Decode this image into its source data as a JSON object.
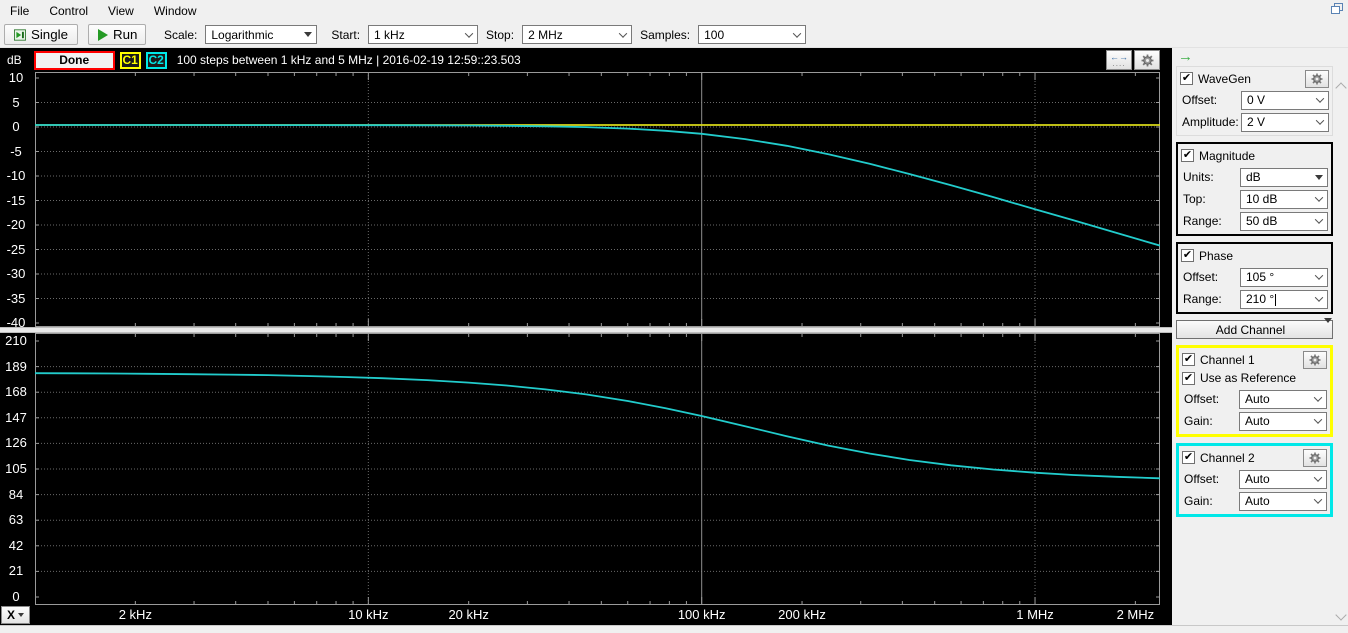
{
  "menu": {
    "items": [
      "File",
      "Control",
      "View",
      "Window"
    ]
  },
  "toolbar": {
    "single_label": "Single",
    "run_label": "Run",
    "scale_label": "Scale:",
    "scale_value": "Logarithmic",
    "start_label": "Start:",
    "start_value": "1 kHz",
    "stop_label": "Stop:",
    "stop_value": "2 MHz",
    "samples_label": "Samples:",
    "samples_value": "100"
  },
  "statusbar": {
    "axis_unit": "dB",
    "done_label": "Done",
    "c1_label": "C1",
    "c2_label": "C2",
    "status_text": "100 steps between 1 kHz and 5 MHz | 2016-02-19 12:59::23.503"
  },
  "panel": {
    "wavegen": {
      "title": "WaveGen",
      "offset_label": "Offset:",
      "offset_value": "0 V",
      "amplitude_label": "Amplitude:",
      "amplitude_value": "2 V"
    },
    "magnitude": {
      "title": "Magnitude",
      "units_label": "Units:",
      "units_value": "dB",
      "top_label": "Top:",
      "top_value": "10 dB",
      "range_label": "Range:",
      "range_value": "50 dB"
    },
    "phase": {
      "title": "Phase",
      "offset_label": "Offset:",
      "offset_value": "105 °",
      "range_label": "Range:",
      "range_value": "210 °"
    },
    "add_channel_label": "Add Channel",
    "channel1": {
      "title": "Channel 1",
      "use_ref_label": "Use as Reference",
      "offset_label": "Offset:",
      "offset_value": "Auto",
      "gain_label": "Gain:",
      "gain_value": "Auto"
    },
    "channel2": {
      "title": "Channel 2",
      "offset_label": "Offset:",
      "offset_value": "Auto",
      "gain_label": "Gain:",
      "gain_value": "Auto"
    }
  },
  "xaxis": {
    "button_label": "X",
    "ticks": [
      {
        "hz": 2000,
        "label": "2 kHz"
      },
      {
        "hz": 10000,
        "label": "10 kHz"
      },
      {
        "hz": 20000,
        "label": "20 kHz"
      },
      {
        "hz": 100000,
        "label": "100 kHz"
      },
      {
        "hz": 200000,
        "label": "200 kHz"
      },
      {
        "hz": 1000000,
        "label": "1 MHz"
      },
      {
        "hz": 2000000,
        "label": "2 MHz"
      }
    ]
  },
  "colors": {
    "c1_trace": "#d9d919",
    "c2_trace": "#22cccc",
    "grid_dotted": "#6a6a6a",
    "grid_solid": "#8d8d8d",
    "plot_border": "#9a9a9a",
    "done_border": "#ff0000",
    "c1_badge": "#ffff00",
    "c2_badge": "#00e8e8",
    "run_green": "#259a25",
    "panel_arrow_green": "#3fae49"
  },
  "chart_data": [
    {
      "type": "line",
      "title": "Magnitude",
      "x_scale": "log",
      "x_range_hz": [
        1000,
        2371000
      ],
      "ylabel": "dB",
      "ylim": [
        -40,
        10
      ],
      "yticks": [
        10,
        5,
        0,
        -5,
        -10,
        -15,
        -20,
        -25,
        -30,
        -35,
        -40
      ],
      "grid_y": [
        5,
        0,
        -5,
        -10,
        -15,
        -20,
        -25,
        -30,
        -35
      ],
      "x_grid": [
        {
          "hz": 10000,
          "style": "dotted"
        },
        {
          "hz": 100000,
          "style": "solid"
        },
        {
          "hz": 1000000,
          "style": "dotted"
        }
      ],
      "x_hz": [
        1000,
        1300,
        1700,
        2200,
        2900,
        3800,
        5000,
        6500,
        8500,
        11000,
        15000,
        20000,
        26000,
        34000,
        45000,
        60000,
        78000,
        100000,
        135000,
        180000,
        240000,
        320000,
        420000,
        560000,
        750000,
        1000000,
        1300000,
        1750000,
        2371000
      ],
      "series": [
        {
          "name": "C1",
          "color": "#d9d919",
          "y": [
            0.4,
            0.4,
            0.4,
            0.4,
            0.4,
            0.4,
            0.4,
            0.4,
            0.4,
            0.4,
            0.4,
            0.4,
            0.4,
            0.4,
            0.4,
            0.4,
            0.4,
            0.4,
            0.4,
            0.4,
            0.4,
            0.4,
            0.4,
            0.4,
            0.4,
            0.4,
            0.4,
            0.4,
            0.4
          ]
        },
        {
          "name": "C2",
          "color": "#22cccc",
          "y": [
            0.4,
            0.4,
            0.4,
            0.4,
            0.4,
            0.39,
            0.39,
            0.38,
            0.37,
            0.37,
            0.35,
            0.31,
            0.25,
            0.15,
            -0.03,
            -0.33,
            -0.77,
            -1.39,
            -2.46,
            -3.84,
            -5.55,
            -7.54,
            -9.6,
            -11.9,
            -14.3,
            -16.8,
            -19.0,
            -21.6,
            -24.2
          ]
        }
      ]
    },
    {
      "type": "line",
      "title": "Phase",
      "x_scale": "log",
      "x_range_hz": [
        1000,
        2371000
      ],
      "ylabel": "°",
      "ylim": [
        0,
        210
      ],
      "yticks": [
        210,
        189,
        168,
        147,
        126,
        105,
        84,
        63,
        42,
        21,
        0
      ],
      "grid_y": [
        189,
        168,
        147,
        126,
        105,
        84,
        63,
        42,
        21
      ],
      "x_grid": [
        {
          "hz": 10000,
          "style": "dotted"
        },
        {
          "hz": 100000,
          "style": "solid"
        },
        {
          "hz": 1000000,
          "style": "dotted"
        }
      ],
      "x_hz": [
        1000,
        1300,
        1700,
        2200,
        2900,
        3800,
        5000,
        6500,
        8500,
        11000,
        15000,
        20000,
        26000,
        34000,
        45000,
        60000,
        78000,
        100000,
        135000,
        180000,
        240000,
        320000,
        420000,
        560000,
        750000,
        1000000,
        1300000,
        1750000,
        2371000
      ],
      "series": [
        {
          "name": "C2",
          "color": "#22cccc",
          "y": [
            183.6,
            183.5,
            183.3,
            183.1,
            182.8,
            182.4,
            182.0,
            181.3,
            180.5,
            179.5,
            177.9,
            175.9,
            173.5,
            170.3,
            166.2,
            160.8,
            154.9,
            148.5,
            140.1,
            131.9,
            124.2,
            117.6,
            112.4,
            108.0,
            104.6,
            102.0,
            100.1,
            98.6,
            97.4
          ]
        }
      ]
    }
  ]
}
